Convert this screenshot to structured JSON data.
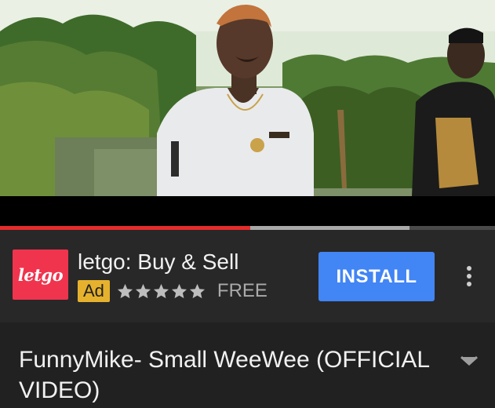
{
  "video": {
    "progress_played": 0.505,
    "progress_buffered": 0.828
  },
  "ad": {
    "logo_text": "letgo",
    "title": "letgo: Buy & Sell",
    "badge": "Ad",
    "rating_stars": 5,
    "price": "FREE",
    "install_label": "INSTALL",
    "more_icon": "more-vert-icon"
  },
  "video_title": {
    "text": "FunnyMike- Small WeeWee (OFFICIAL VIDEO)",
    "expand_icon": "chevron-down-icon"
  },
  "colors": {
    "background": "#212121",
    "ad_card": "#282828",
    "progress_red": "#e52b2b",
    "logo_red": "#f0344e",
    "ad_badge_yellow": "#e6b22e",
    "install_blue": "#4285f4"
  }
}
